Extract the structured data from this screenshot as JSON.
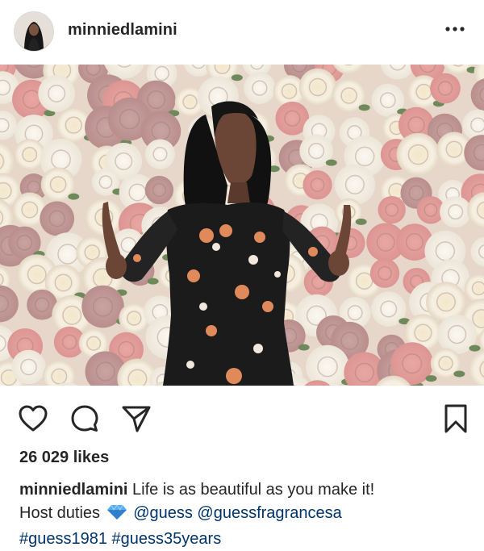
{
  "post": {
    "username": "minniedlamini",
    "likes_text": "26 029 likes",
    "caption": {
      "username": "minniedlamini",
      "text": "Life is as beautiful as you make it!",
      "line2_text": "Host duties",
      "emoji": "gem-stone",
      "mentions": [
        "@guess",
        "@guessfragrancesa"
      ],
      "hashtags": [
        "#guess1981",
        "#guess35years"
      ]
    }
  },
  "icons": {
    "more": "more-options-icon",
    "like": "heart-icon",
    "comment": "comment-icon",
    "share": "share-icon",
    "save": "bookmark-icon"
  },
  "colors": {
    "text": "#262626",
    "link": "#003569",
    "gem": "#3b8fd9"
  }
}
